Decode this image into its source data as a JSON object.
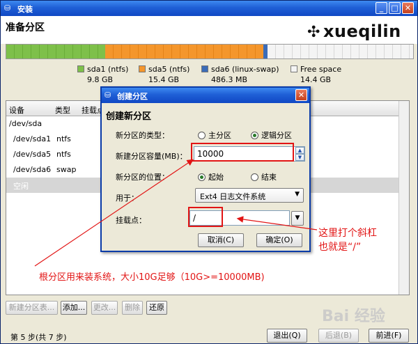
{
  "window": {
    "title": "安装",
    "header": "准备分区",
    "logo_text": "xueqilin"
  },
  "partitions": [
    {
      "name": "sda1 (ntfs)",
      "size": "9.8 GB",
      "color": "#7ec04a"
    },
    {
      "name": "sda5 (ntfs)",
      "size": "15.4 GB",
      "color": "#f4962c"
    },
    {
      "name": "sda6 (linux-swap)",
      "size": "486.3 MB",
      "color": "#3b6cb8"
    },
    {
      "name": "Free space",
      "size": "14.4 GB",
      "color": "#f4f4f4"
    }
  ],
  "table": {
    "columns": [
      "设备",
      "类型",
      "挂载点"
    ],
    "rows": [
      {
        "device": "/dev/sda",
        "type": ""
      },
      {
        "device": "/dev/sda1",
        "type": "ntfs"
      },
      {
        "device": "/dev/sda5",
        "type": "ntfs"
      },
      {
        "device": "/dev/sda6",
        "type": "swap"
      },
      {
        "device": "空闲",
        "type": ""
      }
    ]
  },
  "buttons": {
    "new_table": "新建分区表...",
    "add": "添加...",
    "change": "更改...",
    "delete": "删除",
    "revert": "还原",
    "quit": "退出(Q)",
    "back": "后退(B)",
    "forward": "前进(F)"
  },
  "status": "第 5 步(共 7 步)",
  "dialog": {
    "title": "创建分区",
    "heading": "创建新分区",
    "type_label": "新分区的类型：",
    "type_primary": "主分区",
    "type_logical": "逻辑分区",
    "size_label": "新建分区容量(MB)：",
    "size_value": "10000",
    "pos_label": "新分区的位置：",
    "pos_begin": "起始",
    "pos_end": "结束",
    "use_label": "用于：",
    "use_value": "Ext4 日志文件系统",
    "mount_label": "挂载点：",
    "mount_value": "/",
    "cancel": "取消(C)",
    "ok": "确定(O)"
  },
  "annotations": {
    "slash_line1": "这里打个斜杠",
    "slash_line2": "也就是“/”",
    "size_note": "根分区用来装系统，大小10G足够（10G>=10000MB)"
  },
  "watermark": "Bai 经验",
  "colors": {
    "accent_red": "#e21414",
    "title_blue": "#1f5fd6"
  }
}
